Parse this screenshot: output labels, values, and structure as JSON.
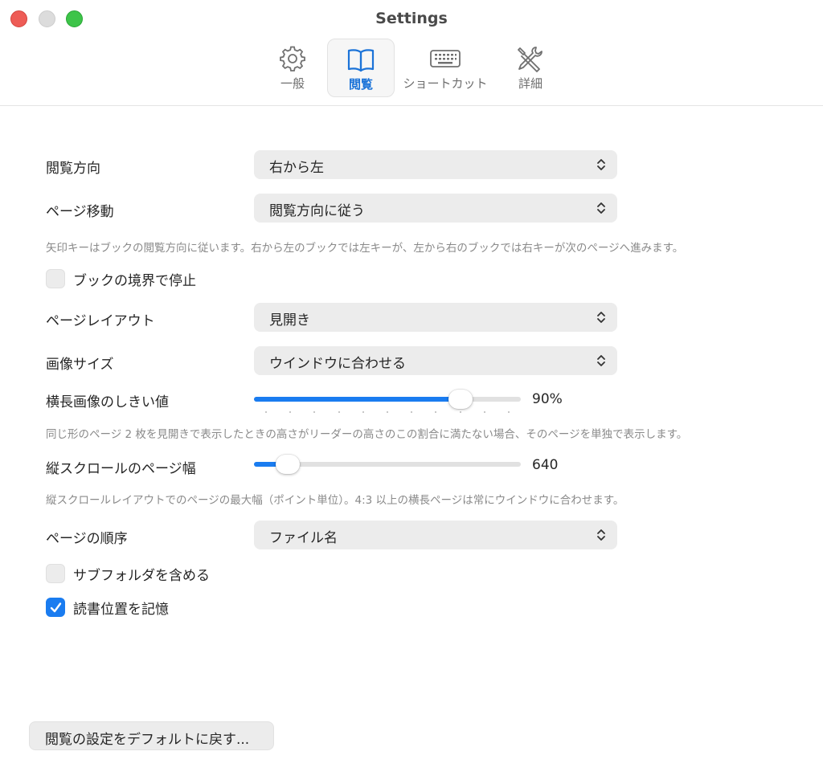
{
  "window": {
    "title": "Settings"
  },
  "toolbar": {
    "tabs": [
      {
        "label": "一般",
        "icon": "gear-icon",
        "selected": false
      },
      {
        "label": "閲覧",
        "icon": "book-icon",
        "selected": true
      },
      {
        "label": "ショートカット",
        "icon": "keyboard-icon",
        "selected": false
      },
      {
        "label": "詳細",
        "icon": "tools-icon",
        "selected": false
      }
    ]
  },
  "settings": {
    "reading_direction": {
      "label": "閲覧方向",
      "value": "右から左"
    },
    "page_navigation": {
      "label": "ページ移動",
      "value": "閲覧方向に従う"
    },
    "page_navigation_hint": "矢印キーはブックの閲覧方向に従います。右から左のブックでは左キーが、左から右のブックでは右キーが次のページへ進みます。",
    "stop_at_book_boundary": {
      "label": "ブックの境界で停止",
      "checked": false
    },
    "page_layout": {
      "label": "ページレイアウト",
      "value": "見開き"
    },
    "image_size": {
      "label": "画像サイズ",
      "value": "ウインドウに合わせる"
    },
    "landscape_threshold": {
      "label": "横長画像のしきい値",
      "value": 0.9,
      "display": "90%"
    },
    "landscape_threshold_hint": "同じ形のページ 2 枚を見開きで表示したときの高さがリーダーの高さのこの割合に満たない場合、そのページを単独で表示します。",
    "vertical_scroll_width": {
      "label": "縦スクロールのページ幅",
      "value": 640,
      "display": "640"
    },
    "vertical_scroll_width_hint": "縦スクロールレイアウトでのページの最大幅（ポイント単位）。4:3 以上の横長ページは常にウインドウに合わせます。",
    "page_order": {
      "label": "ページの順序",
      "value": "ファイル名"
    },
    "include_subfolders": {
      "label": "サブフォルダを含める",
      "checked": false
    },
    "remember_reading_position": {
      "label": "読書位置を記憶",
      "checked": true
    }
  },
  "reset_button": {
    "label": "閲覧の設定をデフォルトに戻す..."
  },
  "colors": {
    "accent": "#1a7cf0",
    "close": "#ee5c56",
    "zoom": "#3dc449"
  }
}
